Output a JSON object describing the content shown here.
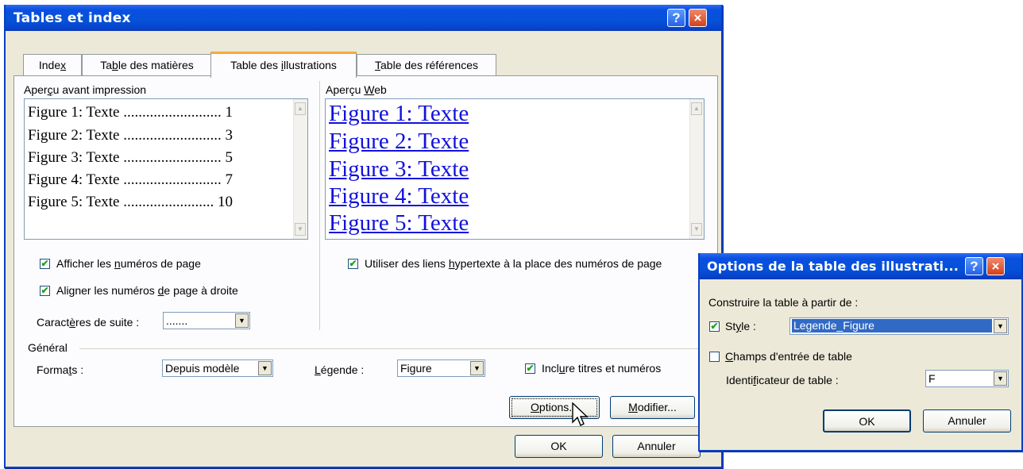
{
  "main_dialog": {
    "title": "Tables et index",
    "help_label": "?",
    "close_label": "×",
    "tabs": [
      {
        "pre": "Inde",
        "ul": "x",
        "post": ""
      },
      {
        "pre": "Ta",
        "ul": "b",
        "post": "le des matières"
      },
      {
        "pre": "Table des ",
        "ul": "i",
        "post": "llustrations"
      },
      {
        "pre": "",
        "ul": "T",
        "post": "able des références"
      }
    ],
    "print_preview": {
      "label_pre": "Aper",
      "label_ul": "ç",
      "label_post": "u avant impression",
      "entries": [
        "Figure 1: Texte .......................... 1",
        "Figure 2: Texte .......................... 3",
        "Figure 3: Texte .......................... 5",
        "Figure 4: Texte .......................... 7",
        "Figure 5: Texte ........................ 10"
      ]
    },
    "web_preview": {
      "label_pre": "Aperçu ",
      "label_ul": "W",
      "label_post": "eb",
      "entries": [
        "Figure 1: Texte",
        "Figure 2: Texte",
        "Figure 3: Texte",
        "Figure 4: Texte",
        "Figure 5: Texte"
      ]
    },
    "show_page_numbers": {
      "pre": "Afficher les ",
      "ul": "n",
      "post": "uméros de page",
      "checked": "✔"
    },
    "align_right": {
      "pre": "Aligner les numéros ",
      "ul": "d",
      "post": "e page à droite",
      "checked": "✔"
    },
    "leader": {
      "pre": "Caract",
      "ul": "è",
      "post": "res de suite :",
      "value": "......."
    },
    "use_hyperlinks": {
      "pre": "Utiliser des liens ",
      "ul": "h",
      "post": "ypertexte à la place des numéros de page",
      "checked": "✔"
    },
    "general": {
      "label": "Général",
      "formats_pre": "Forma",
      "formats_ul": "t",
      "formats_post": "s :",
      "formats_value": "Depuis modèle",
      "legend_pre": "",
      "legend_ul": "L",
      "legend_post": "égende :",
      "legend_value": "Figure",
      "include_pre": "Incl",
      "include_ul": "u",
      "include_post": "re titres et numéros",
      "include_checked": "✔"
    },
    "options_button": {
      "pre": "",
      "ul": "O",
      "post": "ptions..."
    },
    "modify_button": {
      "pre": "",
      "ul": "M",
      "post": "odifier..."
    },
    "ok": "OK",
    "cancel": "Annuler"
  },
  "options_dialog": {
    "title": "Options de la table des illustrati...",
    "help_label": "?",
    "close_label": "×",
    "build_from": "Construire la table à partir de :",
    "style": {
      "pre": "St",
      "ul": "y",
      "post": "le :",
      "checked": "✔",
      "value": "Legende_Figure"
    },
    "fields": {
      "pre": "",
      "ul": "C",
      "post": "hamps d'entrée de table",
      "checked": ""
    },
    "identifier": {
      "pre": "Identi",
      "ul": "f",
      "post": "icateur de table :",
      "value": "F"
    },
    "ok": "OK",
    "cancel": "Annuler"
  },
  "colors": {
    "accent": "#0a4fe0",
    "link": "#1111dd",
    "selection": "#316ac5",
    "dialog_bg": "#ece9d8"
  }
}
